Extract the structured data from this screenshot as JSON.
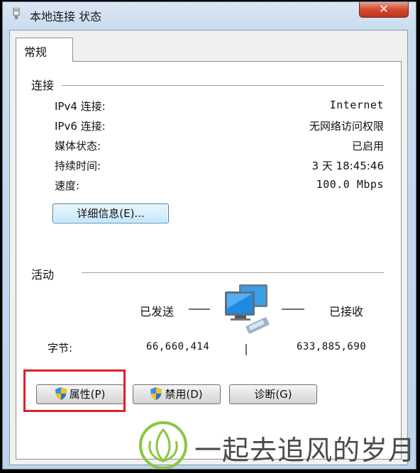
{
  "window": {
    "title": "本地连接 状态",
    "close_glyph": "✕"
  },
  "tabs": [
    {
      "label": "常规"
    }
  ],
  "connection": {
    "section_label": "连接",
    "rows": [
      {
        "label": "IPv4 连接:",
        "value": "Internet"
      },
      {
        "label": "IPv6 连接:",
        "value": "无网络访问权限"
      },
      {
        "label": "媒体状态:",
        "value": "已启用"
      },
      {
        "label": "持续时间:",
        "value": "3 天 18:45:46"
      },
      {
        "label": "速度:",
        "value": "100.0 Mbps"
      }
    ],
    "details_button": "详细信息(E)..."
  },
  "activity": {
    "section_label": "活动",
    "sent_label": "已发送",
    "received_label": "已接收",
    "bytes_label": "字节:",
    "bytes_sent": "66,660,414",
    "bytes_received": "633,885,690"
  },
  "buttons": {
    "properties": "属性(P)",
    "disable": "禁用(D)",
    "diagnose": "诊断(G)"
  },
  "watermark": {
    "text": "一起去追风的岁月"
  },
  "colors": {
    "highlight_box": "#e0202a",
    "window_frame": "#c9dcef"
  }
}
